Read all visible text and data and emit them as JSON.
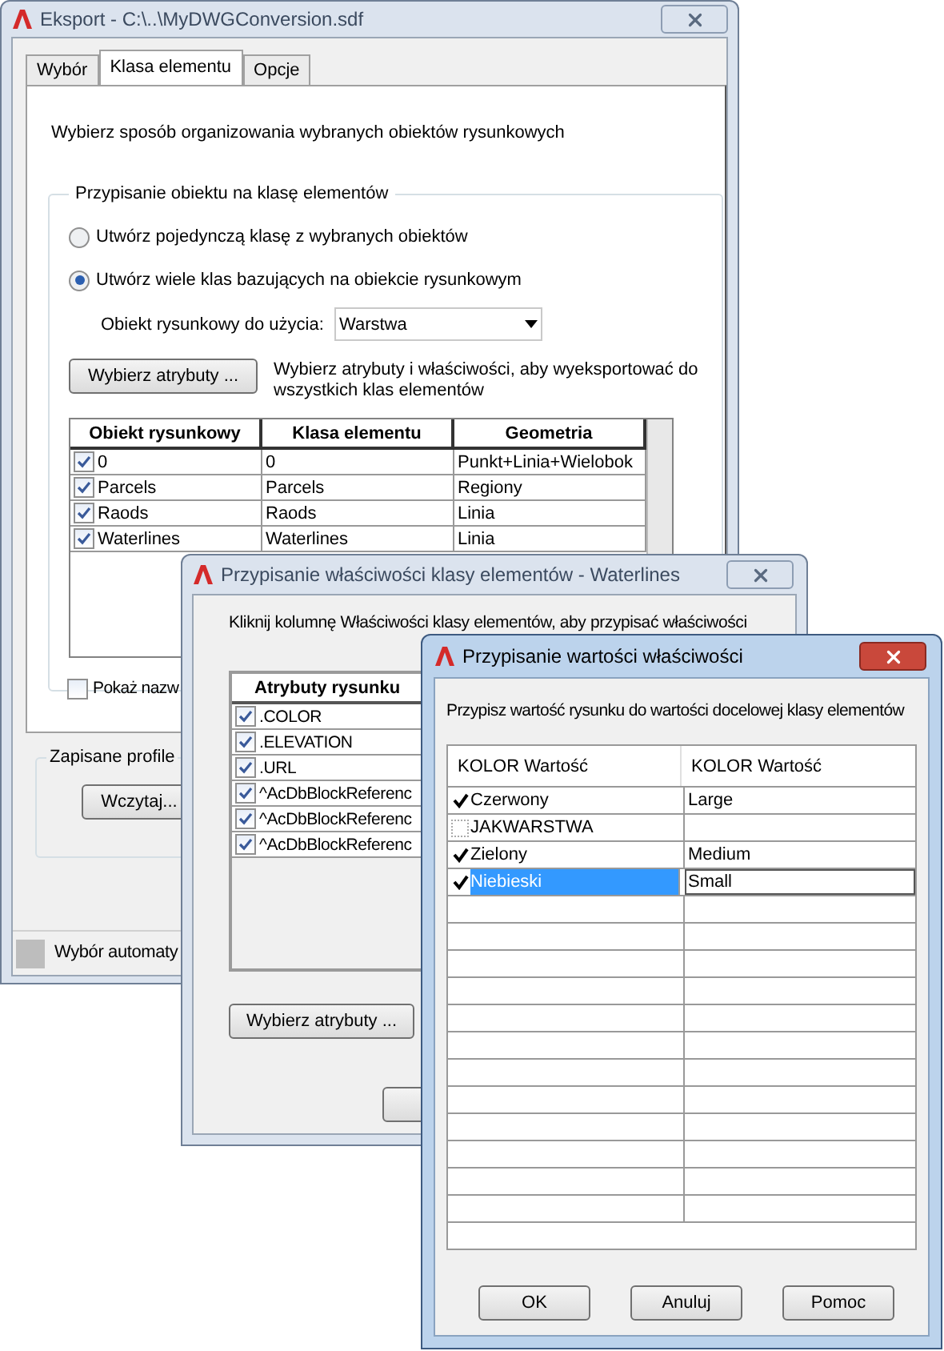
{
  "export_dialog": {
    "title": "Eksport - C:\\..\\MyDWGConversion.sdf",
    "tabs": [
      {
        "label": "Wybór",
        "selected": false
      },
      {
        "label": "Klasa elementu",
        "selected": true
      },
      {
        "label": "Opcje",
        "selected": false
      }
    ],
    "description": "Wybierz sposób organizowania wybranych obiektów rysunkowych",
    "group_title": "Przypisanie obiektu na klasę elementów",
    "options": [
      {
        "label": "Utwórz pojedynczą klasę z wybranych obiektów",
        "selected": false
      },
      {
        "label": "Utwórz wiele klas bazujących na obiekcie rysunkowym",
        "selected": true
      }
    ],
    "object_label": "Obiekt rysunkowy do użycia:",
    "object_value": "Warstwa",
    "attributes_button": "Wybierz atrybuty ...",
    "attributes_hint": "Wybierz atrybuty i właściwości, aby wyeksportować do wszystkich klas elementów",
    "table": {
      "columns": [
        "Obiekt rysunkowy",
        "Klasa elementu",
        "Geometria"
      ],
      "rows": [
        {
          "checked": true,
          "cells": [
            "0",
            "0",
            "Punkt+Linia+Wielobok"
          ]
        },
        {
          "checked": true,
          "cells": [
            "Parcels",
            "Parcels",
            "Regiony"
          ]
        },
        {
          "checked": true,
          "cells": [
            "Raods",
            "Raods",
            "Linia"
          ]
        },
        {
          "checked": true,
          "cells": [
            "Waterlines",
            "Waterlines",
            "Linia"
          ]
        }
      ]
    },
    "show_names": {
      "label": "Pokaż nazw",
      "checked": false
    },
    "profiles_title": "Zapisane profile",
    "load_button": "Wczytaj...",
    "status": "Wybór automaty"
  },
  "properties_dialog": {
    "title": "Przypisanie właściwości klasy elementów - Waterlines",
    "instruction": "Kliknij kolumnę Właściwości klasy elementów, aby przypisać właściwości",
    "column": "Atrybuty rysunku",
    "rows": [
      {
        "label": ".COLOR",
        "checked": true
      },
      {
        "label": ".ELEVATION",
        "checked": true
      },
      {
        "label": ".URL",
        "checked": true
      },
      {
        "label": "^AcDbBlockReferenc",
        "checked": true
      },
      {
        "label": "^AcDbBlockReferenc",
        "checked": true
      },
      {
        "label": "^AcDbBlockReferenc",
        "checked": true
      }
    ],
    "attributes_button": "Wybierz atrybuty ..."
  },
  "values_dialog": {
    "title": "Przypisanie wartości właściwości",
    "instruction": "Przypisz wartość rysunku do wartości docelowej klasy elementów",
    "columns": [
      "KOLOR Wartość",
      "KOLOR Wartość"
    ],
    "rows": [
      {
        "checked": true,
        "selected": false,
        "source": "Czerwony",
        "target": "Large"
      },
      {
        "checked": false,
        "selected": false,
        "source": "JAKWARSTWA"
      },
      {
        "checked": true,
        "selected": false,
        "source": "Zielony",
        "target": "Medium"
      },
      {
        "checked": true,
        "selected": true,
        "source": "Niebieski",
        "target": "Small"
      }
    ],
    "buttons": [
      "OK",
      "Anuluj",
      "Pomoc"
    ]
  }
}
